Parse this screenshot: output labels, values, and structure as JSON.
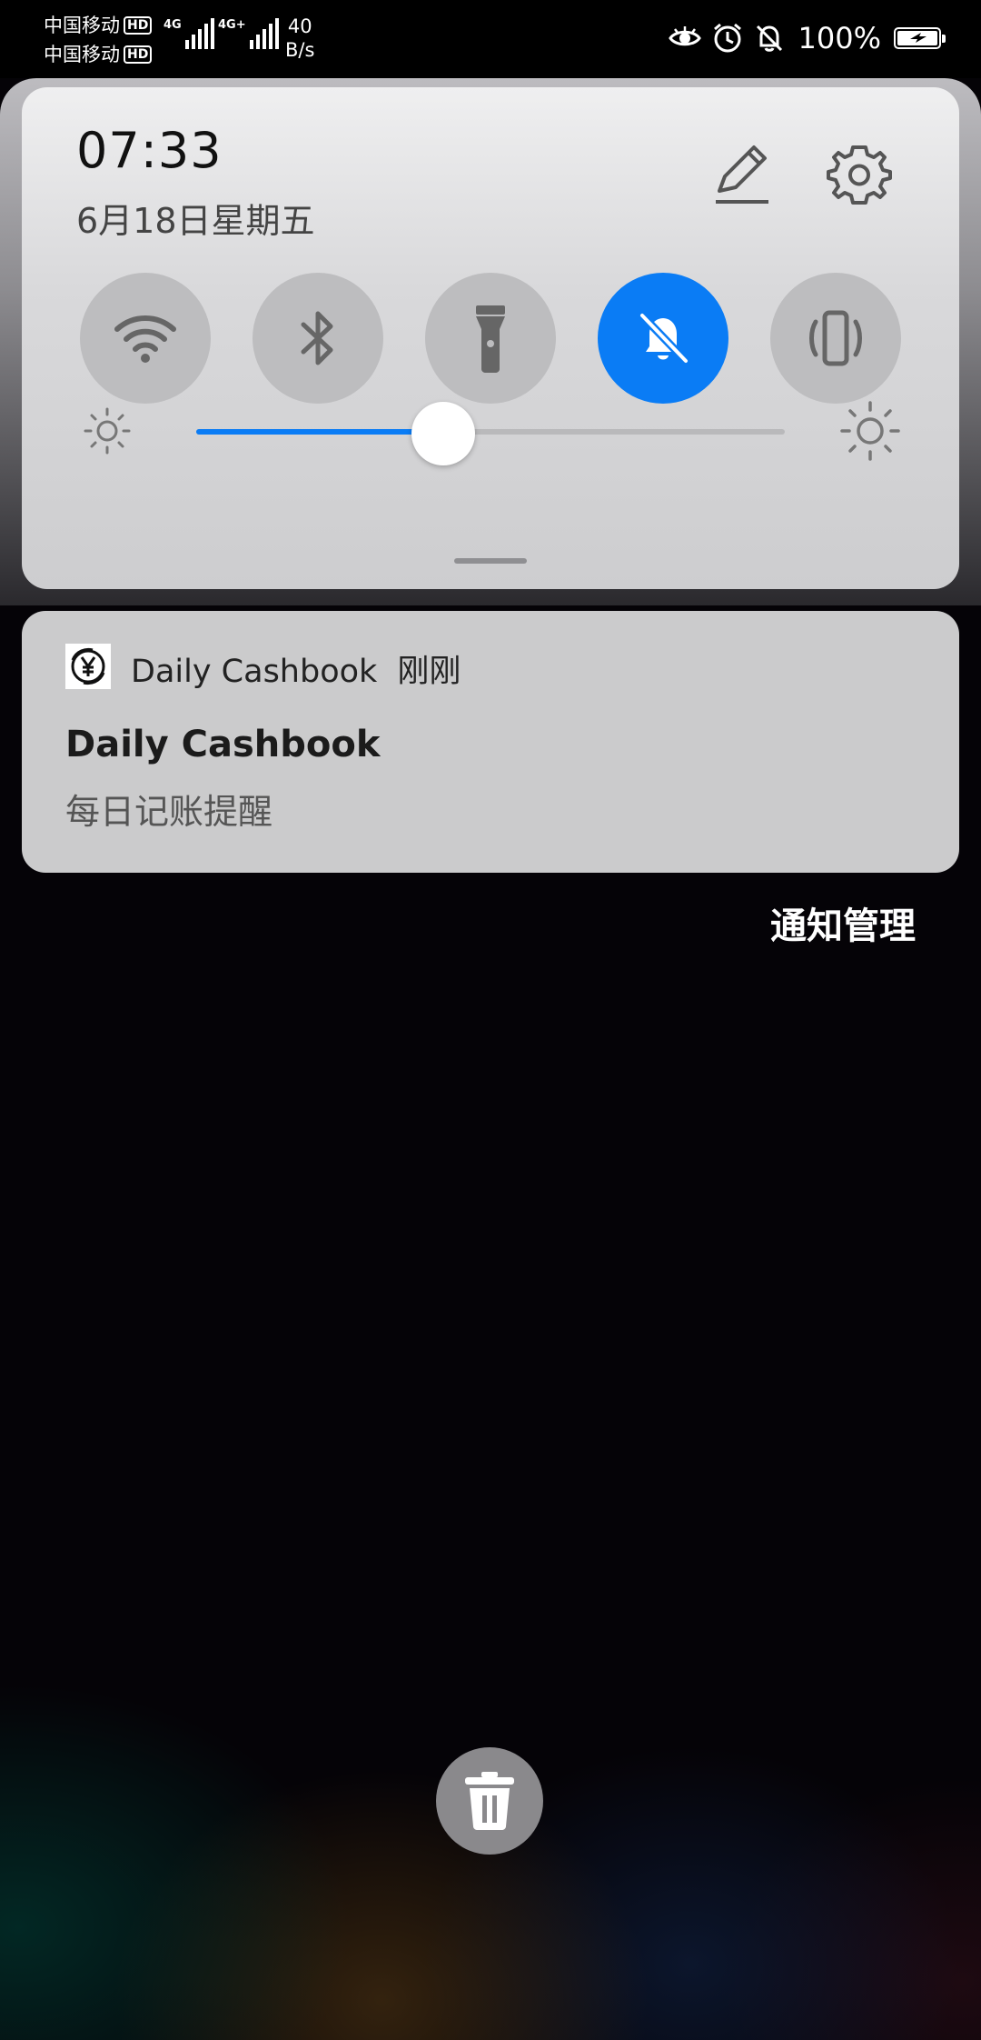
{
  "status_bar": {
    "carrier_1": "中国移动",
    "carrier_2": "中国移动",
    "hd_label": "HD",
    "net_1": "4G",
    "net_2": "4G+",
    "speed_value": "40",
    "speed_unit": "B/s",
    "battery_text": "100%",
    "icons": [
      "eye-icon",
      "alarm-icon",
      "bell-off-icon",
      "battery-charging-icon"
    ]
  },
  "quick_settings": {
    "time": "07:33",
    "date": "6月18日星期五",
    "tiles": [
      {
        "name": "wifi",
        "icon": "wifi-icon",
        "active": false
      },
      {
        "name": "bluetooth",
        "icon": "bluetooth-icon",
        "active": false
      },
      {
        "name": "flashlight",
        "icon": "flashlight-icon",
        "active": false
      },
      {
        "name": "mute",
        "icon": "bell-off-icon",
        "active": true
      },
      {
        "name": "vibrate",
        "icon": "vibrate-icon",
        "active": false
      }
    ],
    "brightness_percent": 42,
    "accent_color": "#0a7cf5"
  },
  "notification": {
    "app_icon": "yen-icon",
    "app_name": "Daily Cashbook",
    "time": "刚刚",
    "title": "Daily Cashbook",
    "body": "每日记账提醒"
  },
  "manage_label": "通知管理",
  "clear_icon": "trash-icon"
}
